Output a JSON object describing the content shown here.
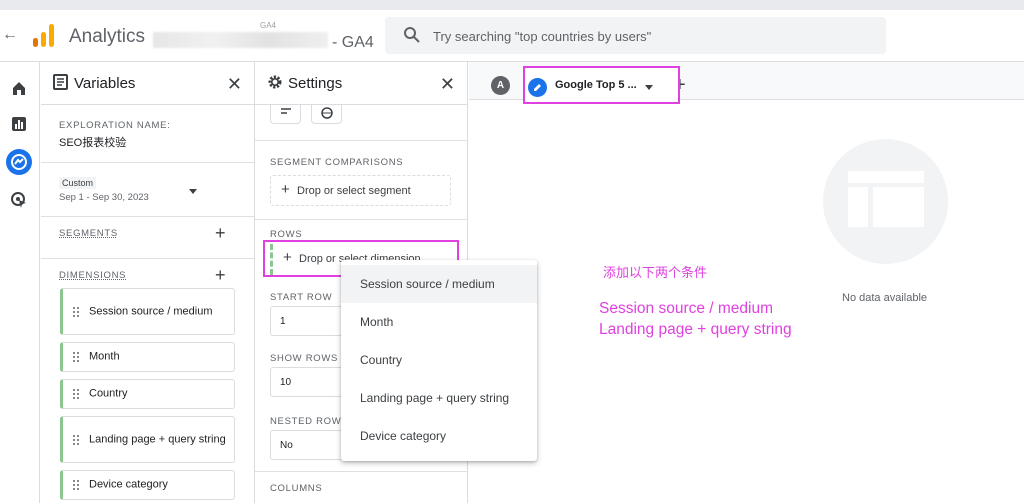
{
  "header": {
    "app_title": "Analytics",
    "account_tag": "GA4",
    "property_suffix": "- GA4",
    "search_placeholder": "Try searching \"top countries by users\""
  },
  "variables_panel": {
    "title": "Variables",
    "exploration_label": "EXPLORATION NAME:",
    "exploration_name": "SEO报表校验",
    "date_tag": "Custom",
    "date_range": "Sep 1 - Sep 30, 2023",
    "segments_label": "SEGMENTS",
    "dimensions_label": "DIMENSIONS",
    "dimensions": [
      "Session source / medium",
      "Month",
      "Country",
      "Landing page + query string",
      "Device category"
    ]
  },
  "settings_panel": {
    "title": "Settings",
    "segment_comparisons_label": "SEGMENT COMPARISONS",
    "segment_drop": "Drop or select segment",
    "rows_label": "ROWS",
    "rows_drop": "Drop or select dimension",
    "start_row_label": "START ROW",
    "start_row_value": "1",
    "show_rows_label": "SHOW ROWS",
    "show_rows_value": "10",
    "nested_rows_label": "NESTED ROWS",
    "nested_rows_value": "No",
    "columns_label": "COLUMNS"
  },
  "tabs": {
    "avatar_letter": "A",
    "active_label": "Google Top 5 ..."
  },
  "canvas": {
    "no_data": "No data available",
    "annotation_cn": "添加以下两个条件",
    "annotation_line1": "Session source / medium",
    "annotation_line2": "Landing page + query string"
  },
  "dropdown": {
    "items": [
      "Session source / medium",
      "Month",
      "Country",
      "Landing page + query string",
      "Device category"
    ]
  },
  "colors": {
    "highlight": "#e040e0",
    "dimension_accent": "#8bc58f",
    "explore_active": "#1a73e8"
  }
}
